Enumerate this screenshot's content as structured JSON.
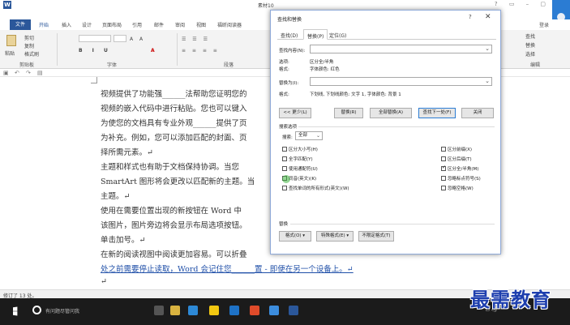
{
  "window": {
    "doc_title": "素材10",
    "file_tab": "文件",
    "ribbon_tabs": [
      "开始",
      "插入",
      "设计",
      "页面布局",
      "引用",
      "邮件",
      "审阅",
      "视图",
      "福昕阅读器"
    ],
    "login": "登录",
    "ribbon_groups": [
      "剪贴板",
      "字体",
      "段落",
      "编辑"
    ],
    "paste_label": "粘贴",
    "clipboard_items": [
      "剪切",
      "复制",
      "格式刷"
    ],
    "editing_items": [
      "查找",
      "替换",
      "选择"
    ]
  },
  "document": {
    "lines": [
      {
        "text": "视频提供了功能强______法帮助您证明您的",
        "link": false
      },
      {
        "text": "视频的嵌入代码中进行粘贴。您也可以键入",
        "link": false
      },
      {
        "text": "为使您的文档具有专业外观______提供了页",
        "link": false
      },
      {
        "text": "为补充。例如，您可以添加匹配的封面、页",
        "link": false
      },
      {
        "text": "择所需元素。↵",
        "link": false
      },
      {
        "text": "主题和样式也有助于文档保持协调。当您",
        "link": false
      },
      {
        "text": "SmartArt 图形将会更改以匹配新的主题。当",
        "link": false
      },
      {
        "text": "主题。↵",
        "link": false
      },
      {
        "text": "使用在需要位置出现的新按钮在 Word 中",
        "link": false
      },
      {
        "text": "该图片，图片旁边将会显示布局选项按钮。",
        "link": false
      },
      {
        "text": "单击加号。↵",
        "link": false
      },
      {
        "text": "在新的阅读视图中阅读更加容易。可以折叠",
        "link": false
      },
      {
        "text": "处之前需要停止读取，Word 会记住您______置 - 即便在另一个设备上。↵",
        "link": true
      },
      {
        "text": "↵",
        "link": false
      }
    ]
  },
  "status": {
    "text": "修订了 13 处。"
  },
  "taskbar": {
    "search_text": "有问题尽管问我",
    "icon_colors": [
      "#555555",
      "#d9b340",
      "#2d89d6",
      "#f2c811",
      "#1e72c6",
      "#e04b2a",
      "#3c8dde",
      "#2b579a"
    ]
  },
  "watermark": "最需教育",
  "dialog": {
    "title": "查找和替换",
    "help": "?",
    "close": "✕",
    "tabs": [
      "查找(D)",
      "替换(P)",
      "定位(G)"
    ],
    "active_tab": 1,
    "find_label": "查找内容(N):",
    "find_value": "",
    "find_options_label": "选项:",
    "find_options_value": "区分全/半角",
    "find_format_label": "格式:",
    "find_format_value": "字体颜色: 红色",
    "replace_label": "替换为(I):",
    "replace_value": "",
    "replace_format_label": "格式:",
    "replace_format_value": "下划线, 下划线颜色: 文字 1, 字体颜色: 背景 1",
    "buttons": {
      "less": "<< 更少(L)",
      "replace": "替换(R)",
      "replace_all": "全部替换(A)",
      "find_next": "查找下一处(F)",
      "close": "关闭"
    },
    "search_options_label": "搜索选项",
    "search_label": "搜索:",
    "search_value": "全部",
    "left_options": [
      {
        "label": "区分大小写(H)",
        "checked": false
      },
      {
        "label": "全字匹配(Y)",
        "checked": false
      },
      {
        "label": "使用通配符(U)",
        "checked": false
      },
      {
        "label": "同音(英文)(K)",
        "checked": false
      },
      {
        "label": "查找单词的所有形式(英文)(W)",
        "checked": false
      }
    ],
    "right_options": [
      {
        "label": "区分前缀(X)",
        "checked": false
      },
      {
        "label": "区分后缀(T)",
        "checked": false
      },
      {
        "label": "区分全/半角(M)",
        "checked": true
      },
      {
        "label": "忽略标点符号(S)",
        "checked": false
      },
      {
        "label": "忽略空格(W)",
        "checked": false
      }
    ],
    "replace_section_label": "替换",
    "bottom_buttons": [
      "格式(O) ▾",
      "特殊格式(E) ▾",
      "不限定格式(T)"
    ]
  }
}
